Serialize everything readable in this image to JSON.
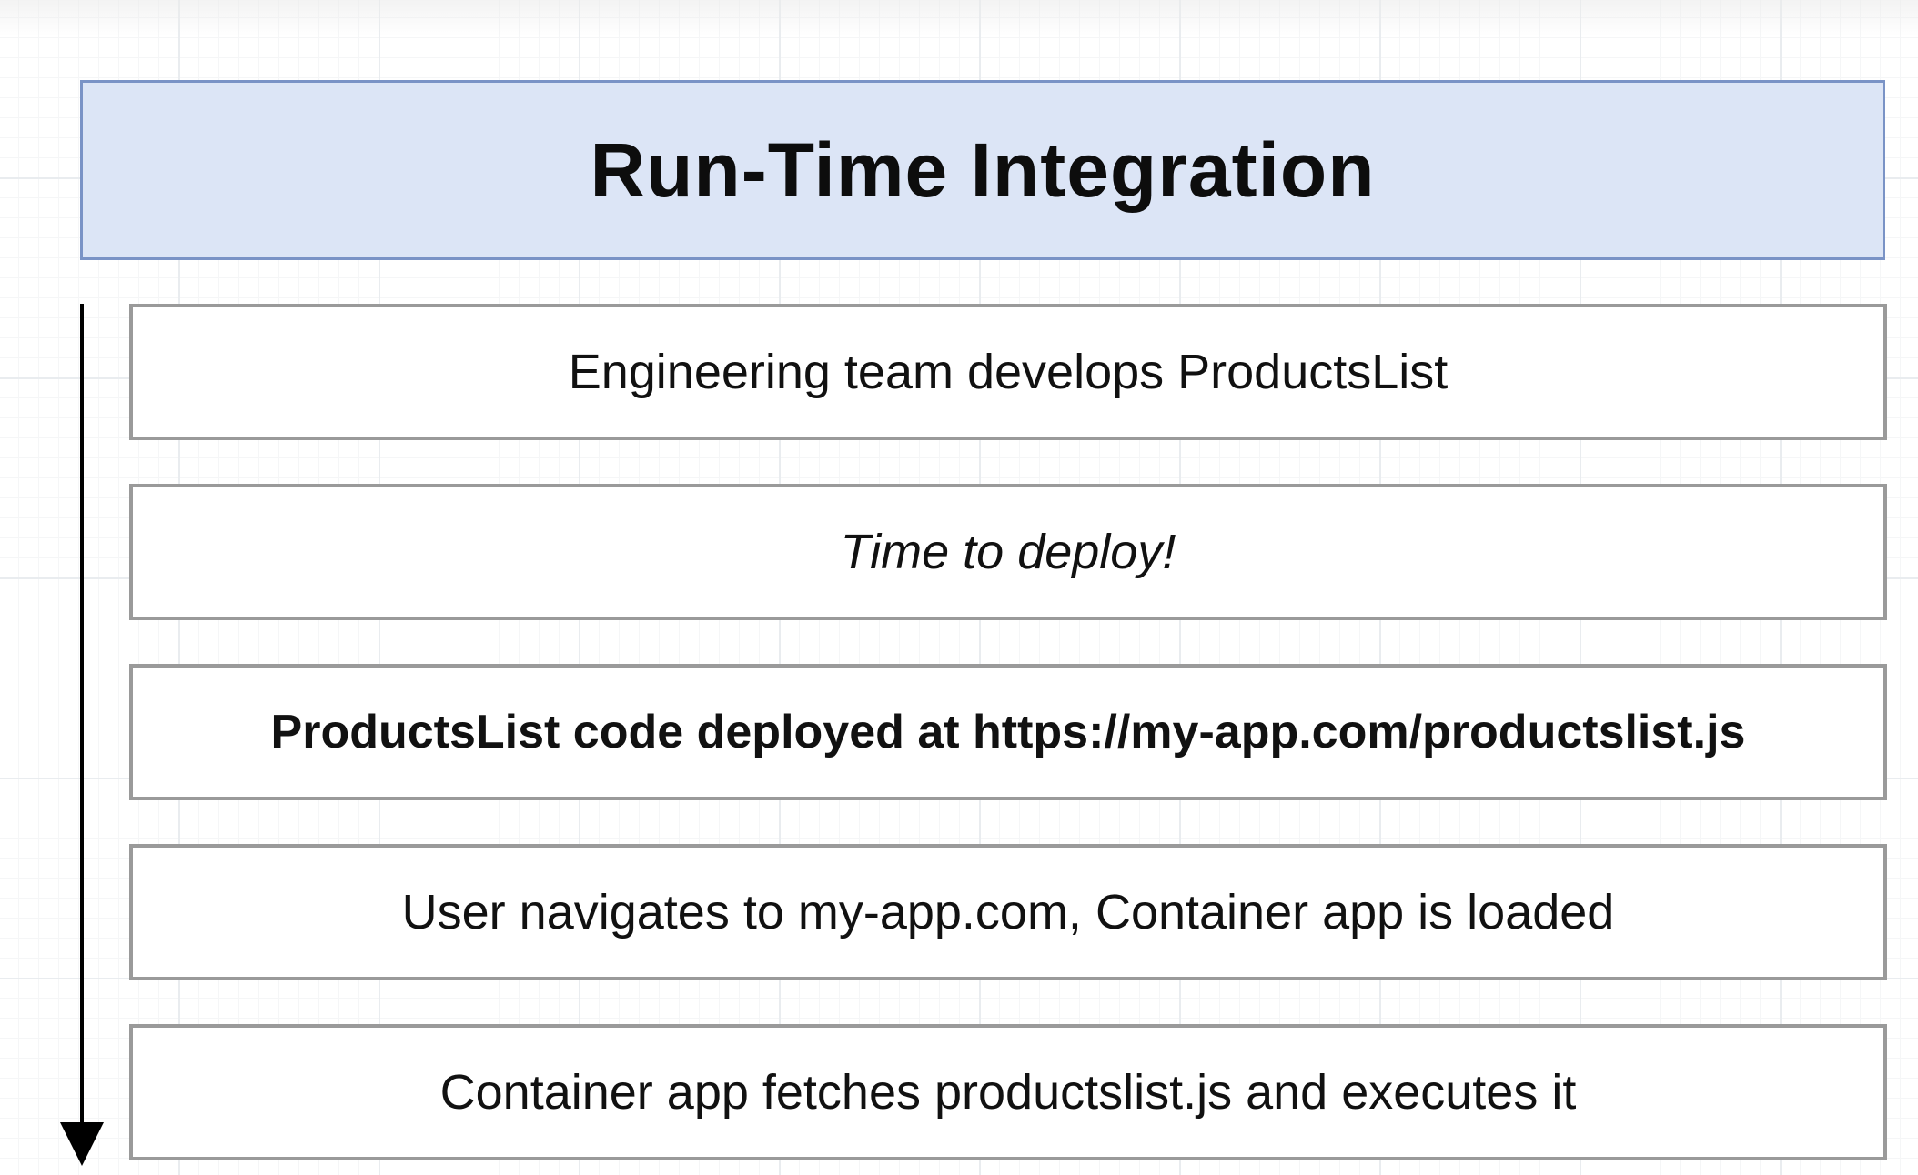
{
  "diagram": {
    "title": "Run-Time Integration",
    "steps": [
      {
        "text": "Engineering team develops ProductsList",
        "style": "normal"
      },
      {
        "text": "Time to deploy!",
        "style": "italic"
      },
      {
        "text": "ProductsList code deployed at https://my-app.com/productslist.js",
        "style": "bold"
      },
      {
        "text": "User navigates to my-app.com, Container app is loaded",
        "style": "normal"
      },
      {
        "text": "Container app fetches productslist.js and executes it",
        "style": "normal"
      }
    ],
    "colors": {
      "header_fill": "#dce5f6",
      "header_border": "#7a93c6",
      "step_border": "#9a9a9a",
      "arrow": "#000000"
    }
  }
}
